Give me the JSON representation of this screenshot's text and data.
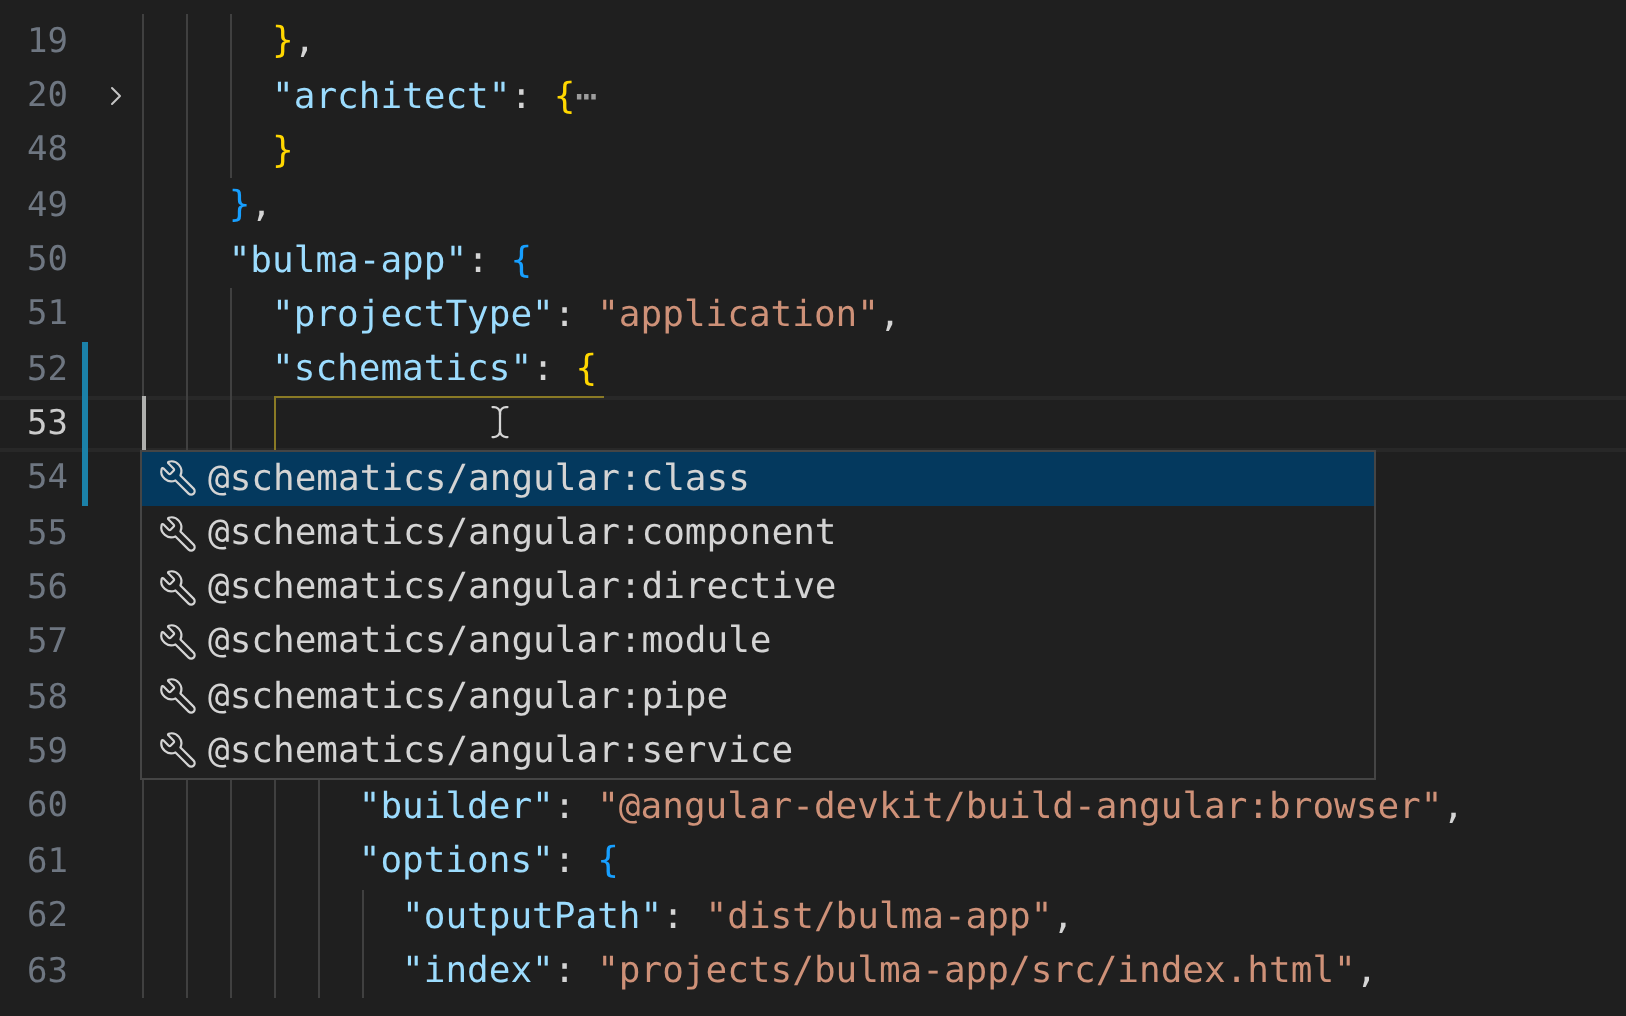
{
  "editor": {
    "lines": [
      {
        "number": "19",
        "tokens": [
          {
            "kind": "bracket",
            "text": "      }",
            "color": "#ffd700"
          },
          {
            "kind": "punct",
            "text": ","
          }
        ]
      },
      {
        "number": "20",
        "folded": true,
        "tokens": [
          {
            "kind": "key",
            "text": "      \"architect\""
          },
          {
            "kind": "punct",
            "text": ": "
          },
          {
            "kind": "bracket",
            "text": "{",
            "color": "#ffd700"
          },
          {
            "kind": "ellipsis",
            "text": "⋯"
          }
        ]
      },
      {
        "number": "48",
        "tokens": [
          {
            "kind": "bracket",
            "text": "      }",
            "color": "#ffd700"
          }
        ]
      },
      {
        "number": "49",
        "tokens": [
          {
            "kind": "bracket",
            "text": "    }",
            "color": "#179fff"
          },
          {
            "kind": "punct",
            "text": ","
          }
        ]
      },
      {
        "number": "50",
        "tokens": [
          {
            "kind": "key",
            "text": "    \"bulma-app\""
          },
          {
            "kind": "punct",
            "text": ": "
          },
          {
            "kind": "bracket",
            "text": "{",
            "color": "#179fff"
          }
        ]
      },
      {
        "number": "51",
        "tokens": [
          {
            "kind": "key",
            "text": "      \"projectType\""
          },
          {
            "kind": "punct",
            "text": ": "
          },
          {
            "kind": "string",
            "text": "\"application\""
          },
          {
            "kind": "punct",
            "text": ","
          }
        ]
      },
      {
        "number": "52",
        "modified": true,
        "tokens": [
          {
            "kind": "key",
            "text": "      \"schematics\""
          },
          {
            "kind": "punct",
            "text": ": "
          },
          {
            "kind": "bracket",
            "text": "{",
            "color": "#ffd700"
          }
        ]
      },
      {
        "number": "53",
        "modified": true,
        "current": true
      },
      {
        "number": "54",
        "modified": true
      },
      {
        "number": "55"
      },
      {
        "number": "56"
      },
      {
        "number": "57"
      },
      {
        "number": "58"
      },
      {
        "number": "59"
      },
      {
        "number": "60",
        "tokens": [
          {
            "kind": "key",
            "text": "          \"builder\""
          },
          {
            "kind": "punct",
            "text": ": "
          },
          {
            "kind": "string",
            "text": "\"@angular-devkit/build-angular:browser\""
          },
          {
            "kind": "punct",
            "text": ","
          }
        ]
      },
      {
        "number": "61",
        "tokens": [
          {
            "kind": "key",
            "text": "          \"options\""
          },
          {
            "kind": "punct",
            "text": ": "
          },
          {
            "kind": "bracket",
            "text": "{",
            "color": "#179fff"
          }
        ]
      },
      {
        "number": "62",
        "tokens": [
          {
            "kind": "key",
            "text": "            \"outputPath\""
          },
          {
            "kind": "punct",
            "text": ": "
          },
          {
            "kind": "string",
            "text": "\"dist/bulma-app\""
          },
          {
            "kind": "punct",
            "text": ","
          }
        ]
      },
      {
        "number": "63",
        "tokens": [
          {
            "kind": "key",
            "text": "            \"index\""
          },
          {
            "kind": "punct",
            "text": ": "
          },
          {
            "kind": "string",
            "text": "\"projects/bulma-app/src/index.html\""
          },
          {
            "kind": "punct",
            "text": ","
          }
        ]
      }
    ]
  },
  "suggestions": [
    {
      "label": "@schematics/angular:class",
      "selected": true
    },
    {
      "label": "@schematics/angular:component",
      "selected": false
    },
    {
      "label": "@schematics/angular:directive",
      "selected": false
    },
    {
      "label": "@schematics/angular:module",
      "selected": false
    },
    {
      "label": "@schematics/angular:pipe",
      "selected": false
    },
    {
      "label": "@schematics/angular:service",
      "selected": false
    }
  ]
}
